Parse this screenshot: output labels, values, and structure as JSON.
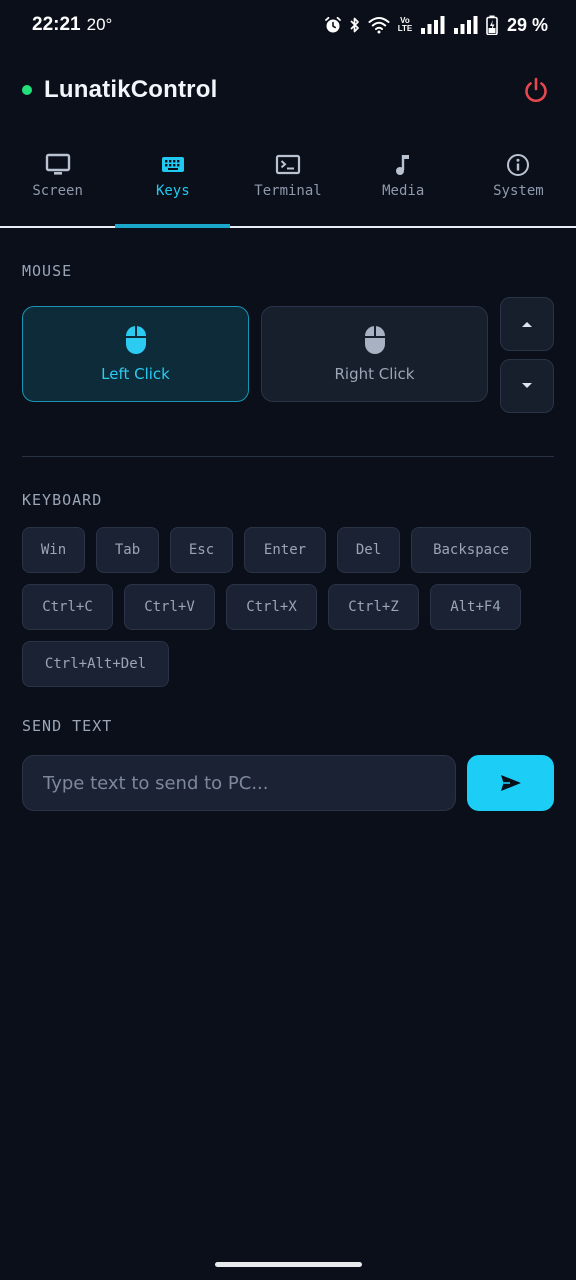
{
  "status_bar": {
    "time": "22:21",
    "temperature": "20°",
    "network_label": "Vo LTE",
    "battery_percent": "29 %"
  },
  "header": {
    "title": "LunatikControl",
    "connection_color": "#22e07a",
    "power_icon": "power-icon",
    "power_color": "#e5484d"
  },
  "tabs": [
    {
      "label": "Screen",
      "icon": "monitor-icon",
      "active": false
    },
    {
      "label": "Keys",
      "icon": "keyboard-icon",
      "active": true
    },
    {
      "label": "Terminal",
      "icon": "terminal-icon",
      "active": false
    },
    {
      "label": "Media",
      "icon": "music-note-icon",
      "active": false
    },
    {
      "label": "System",
      "icon": "info-icon",
      "active": false
    }
  ],
  "mouse": {
    "section_label": "MOUSE",
    "left_click": "Left Click",
    "right_click": "Right Click",
    "scroll_up_icon": "caret-up-icon",
    "scroll_down_icon": "caret-down-icon"
  },
  "keyboard": {
    "section_label": "KEYBOARD",
    "rows": [
      [
        "Win",
        "Tab",
        "Esc",
        "Enter",
        "Del",
        "Backspace"
      ],
      [
        "Ctrl+C",
        "Ctrl+V",
        "Ctrl+X",
        "Ctrl+Z",
        "Alt+F4"
      ],
      [
        "Ctrl+Alt+Del"
      ]
    ]
  },
  "send_text": {
    "section_label": "SEND TEXT",
    "placeholder": "Type text to send to PC...",
    "value": "",
    "send_icon": "send-icon"
  },
  "colors": {
    "accent": "#1ccef6",
    "background": "#0a0f1a",
    "surface": "#1a2233"
  }
}
